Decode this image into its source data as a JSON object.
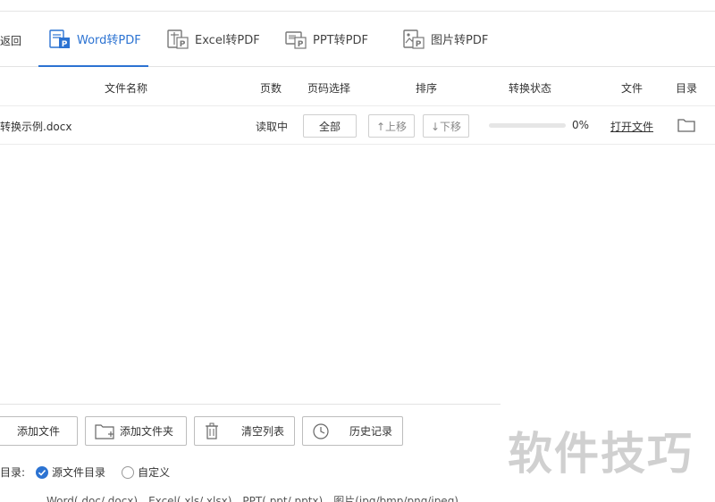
{
  "header": {
    "back_label": "返回",
    "tabs": [
      {
        "label": "Word转PDF",
        "active": true,
        "icon": "word-file-icon"
      },
      {
        "label": "Excel转PDF",
        "active": false,
        "icon": "excel-file-icon"
      },
      {
        "label": "PPT转PDF",
        "active": false,
        "icon": "ppt-file-icon"
      },
      {
        "label": "图片转PDF",
        "active": false,
        "icon": "image-file-icon"
      }
    ]
  },
  "table": {
    "columns": {
      "filename": "文件名称",
      "pages": "页数",
      "page_select": "页码选择",
      "order": "排序",
      "status": "转换状态",
      "file": "文件",
      "dir": "目录"
    },
    "rows": [
      {
        "filename": "转换示例.docx",
        "pages": "读取中",
        "page_select": "全部",
        "move_up": "↑上移",
        "move_down": "↓下移",
        "progress_percent": 0,
        "progress_label": "0%",
        "open_file": "打开文件"
      }
    ]
  },
  "actions": {
    "add_file": "添加文件",
    "add_folder": "添加文件夹",
    "clear_list": "清空列表",
    "history": "历史记录"
  },
  "output": {
    "label": "目录:",
    "option_source": "源文件目录",
    "option_custom": "自定义",
    "selected": "source"
  },
  "footer_text": "Word(.doc/.docx)、Excel(.xls/.xlsx)、PPT(.ppt/.pptx)、图片(jpg/bmp/png/jpeg)",
  "watermark": "软件技巧",
  "colors": {
    "accent": "#2c73d2",
    "border": "#cfcfcf"
  }
}
